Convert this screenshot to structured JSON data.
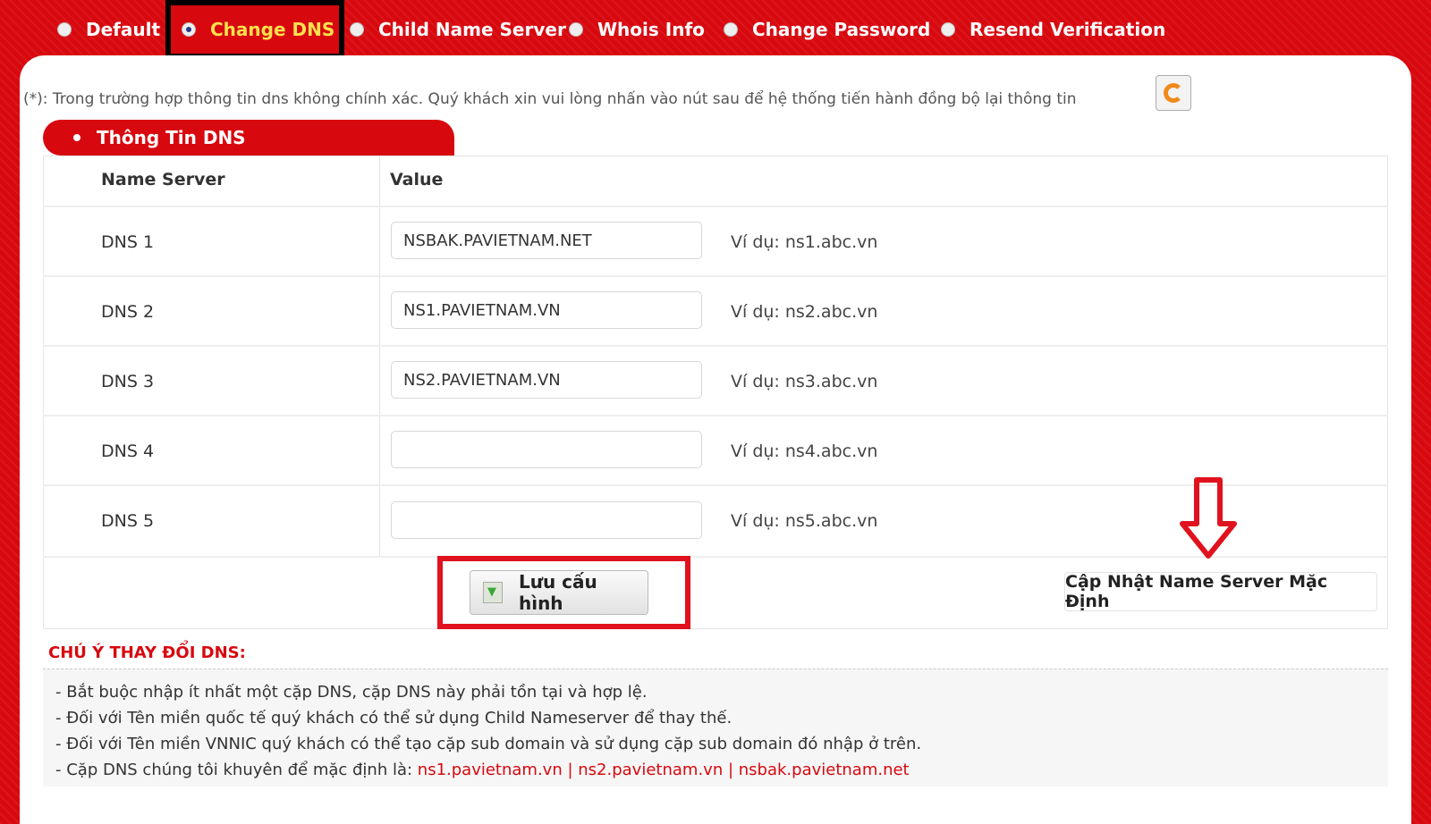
{
  "tabs": [
    {
      "label": "Default",
      "active": false
    },
    {
      "label": "Change DNS",
      "active": true
    },
    {
      "label": "Child Name Server",
      "active": false
    },
    {
      "label": "Whois Info",
      "active": false
    },
    {
      "label": "Change Password",
      "active": false
    },
    {
      "label": "Resend Verification",
      "active": false
    }
  ],
  "notice": "(*): Trong trường hợp thông tin dns không chính xác. Quý khách xin vui lòng nhấn vào nút sau để hệ thống tiến hành đồng bộ lại thông tin",
  "section_title": "Thông Tin DNS",
  "table": {
    "col_name": "Name Server",
    "col_value": "Value",
    "rows": [
      {
        "label": "DNS 1",
        "value": "NSBAK.PAVIETNAM.NET",
        "example": "Ví dụ: ns1.abc.vn"
      },
      {
        "label": "DNS 2",
        "value": "NS1.PAVIETNAM.VN",
        "example": "Ví dụ: ns2.abc.vn"
      },
      {
        "label": "DNS 3",
        "value": "NS2.PAVIETNAM.VN",
        "example": "Ví dụ: ns3.abc.vn"
      },
      {
        "label": "DNS 4",
        "value": "",
        "example": "Ví dụ: ns4.abc.vn"
      },
      {
        "label": "DNS 5",
        "value": "",
        "example": "Ví dụ: ns5.abc.vn"
      }
    ]
  },
  "buttons": {
    "save": "Lưu cấu hình",
    "update_default": "Cập Nhật Name Server Mặc Định"
  },
  "notes": {
    "title": "CHÚ Ý THAY ĐỔI DNS:",
    "lines": [
      "-  Bắt buộc nhập ít nhất một cặp DNS, cặp DNS này phải tồn tại và hợp lệ.",
      "-  Đối với Tên miền quốc tế quý khách có thể sử dụng Child Nameserver để thay thế.",
      "-  Đối với Tên miền VNNIC quý khách có thể tạo cặp sub domain và sử dụng cặp sub domain đó nhập ở trên."
    ],
    "last_prefix": "-  Cặp DNS chúng tôi khuyên để mặc định là: ",
    "recommended": [
      "ns1.pavietnam.vn",
      "ns2.pavietnam.vn",
      "nsbak.pavietnam.net"
    ],
    "separator": " | "
  },
  "colors": {
    "brand_red": "#d8080f",
    "active_tab": "#ffe14d",
    "refresh_orange": "#f08a1a"
  },
  "icons": {
    "refresh": "refresh-icon",
    "save": "save-icon",
    "arrow": "down-arrow-icon"
  }
}
